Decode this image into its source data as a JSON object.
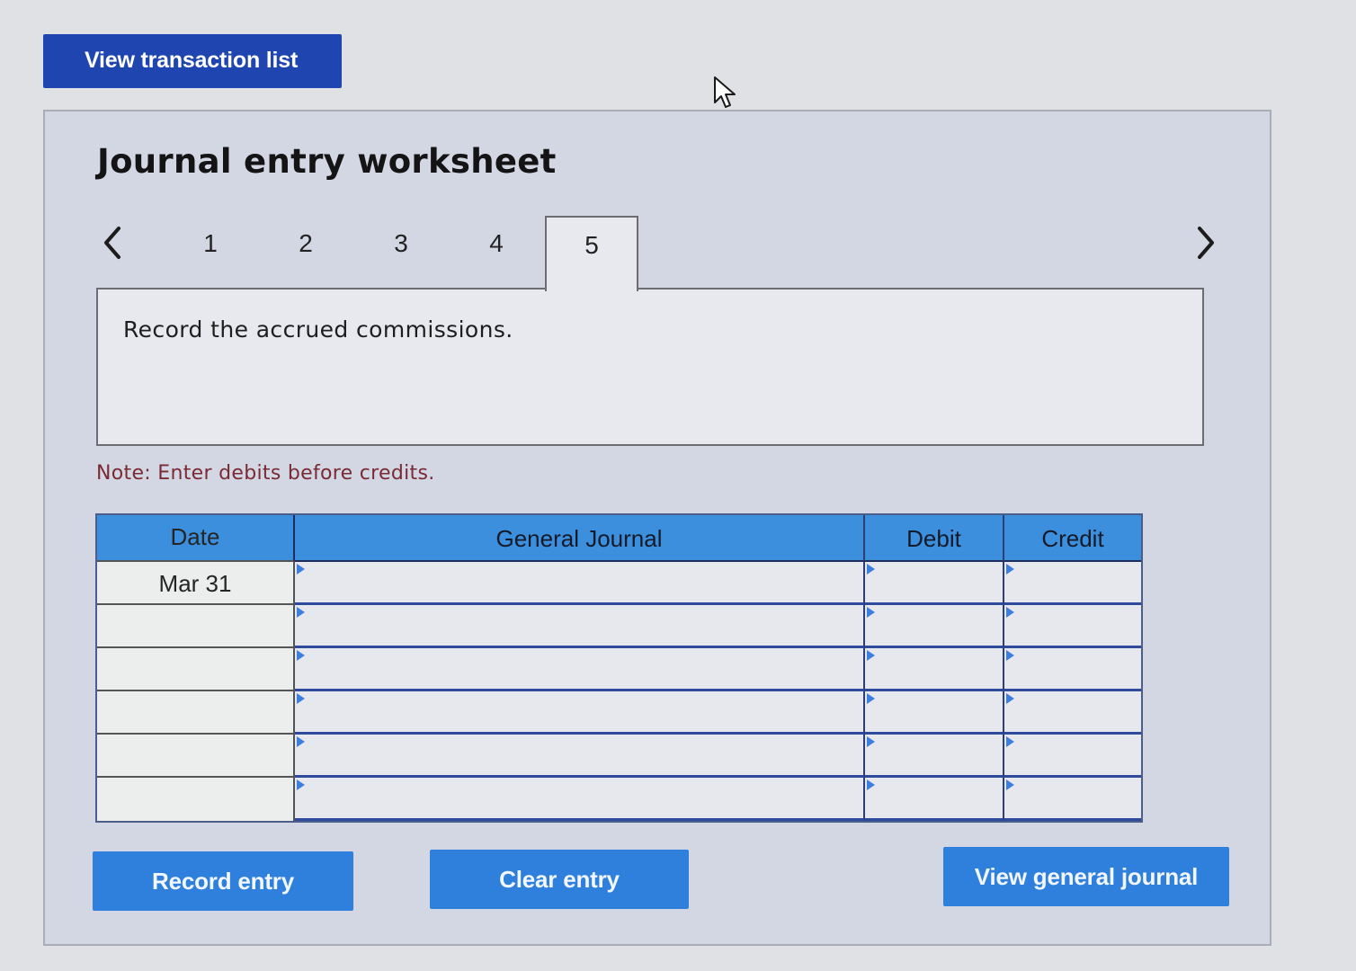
{
  "top_button": {
    "label": "View transaction list"
  },
  "worksheet": {
    "title": "Journal entry worksheet",
    "tabs": [
      "1",
      "2",
      "3",
      "4",
      "5"
    ],
    "active_tab": "5",
    "prompt": "Record the accrued commissions.",
    "note": "Note: Enter debits before credits."
  },
  "journal": {
    "headers": {
      "date": "Date",
      "general_journal": "General Journal",
      "debit": "Debit",
      "credit": "Credit"
    },
    "rows": [
      {
        "date": "Mar 31",
        "account": "",
        "debit": "",
        "credit": ""
      },
      {
        "date": "",
        "account": "",
        "debit": "",
        "credit": ""
      },
      {
        "date": "",
        "account": "",
        "debit": "",
        "credit": ""
      },
      {
        "date": "",
        "account": "",
        "debit": "",
        "credit": ""
      },
      {
        "date": "",
        "account": "",
        "debit": "",
        "credit": ""
      },
      {
        "date": "",
        "account": "",
        "debit": "",
        "credit": ""
      }
    ]
  },
  "buttons": {
    "record": "Record entry",
    "clear": "Clear entry",
    "view_journal": "View general journal"
  },
  "colors": {
    "top_button": "#1f45b0",
    "action_button": "#2f80dc",
    "table_header": "#3c8fdc",
    "note_text": "#7a2a32"
  },
  "icons": {
    "prev": "chevron-left-icon",
    "next": "chevron-right-icon",
    "cursor": "mouse-pointer-icon"
  }
}
